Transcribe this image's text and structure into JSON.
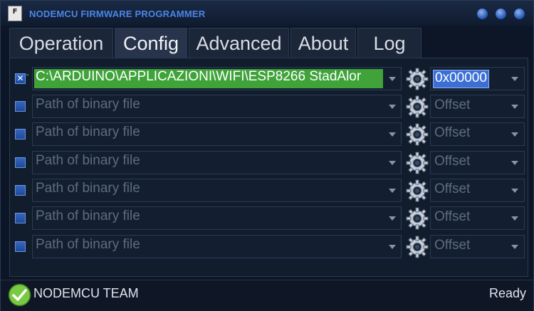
{
  "window": {
    "title": "NODEMCU FIRMWARE PROGRAMMER",
    "app_icon_glyph": "F",
    "buttons": [
      "minimize",
      "maximize",
      "close"
    ]
  },
  "tabs": [
    {
      "label": "Operation",
      "active": false
    },
    {
      "label": "Config",
      "active": true
    },
    {
      "label": "Advanced",
      "active": false
    },
    {
      "label": "About",
      "active": false
    },
    {
      "label": "Log",
      "active": false
    }
  ],
  "config": {
    "rows": [
      {
        "checked": true,
        "path": "C:\\ARDUINO\\APPLICAZIONI\\WIFI\\ESP8266 StadAlor",
        "offset": "0x00000"
      },
      {
        "checked": false,
        "path": "Path of binary file",
        "offset": "Offset"
      },
      {
        "checked": false,
        "path": "Path of binary file",
        "offset": "Offset"
      },
      {
        "checked": false,
        "path": "Path of binary file",
        "offset": "Offset"
      },
      {
        "checked": false,
        "path": "Path of binary file",
        "offset": "Offset"
      },
      {
        "checked": false,
        "path": "Path of binary file",
        "offset": "Offset"
      },
      {
        "checked": false,
        "path": "Path of binary file",
        "offset": "Offset"
      }
    ],
    "checkbox_mark": "✕",
    "row_marker": "ⁿ"
  },
  "status": {
    "left": "NODEMCU TEAM",
    "right": "Ready"
  },
  "colors": {
    "accent": "#4a86e8",
    "selected_path_bg": "#3fa33a",
    "selected_offset_bg": "#3b6fd6",
    "status_ok": "#7ac943"
  }
}
